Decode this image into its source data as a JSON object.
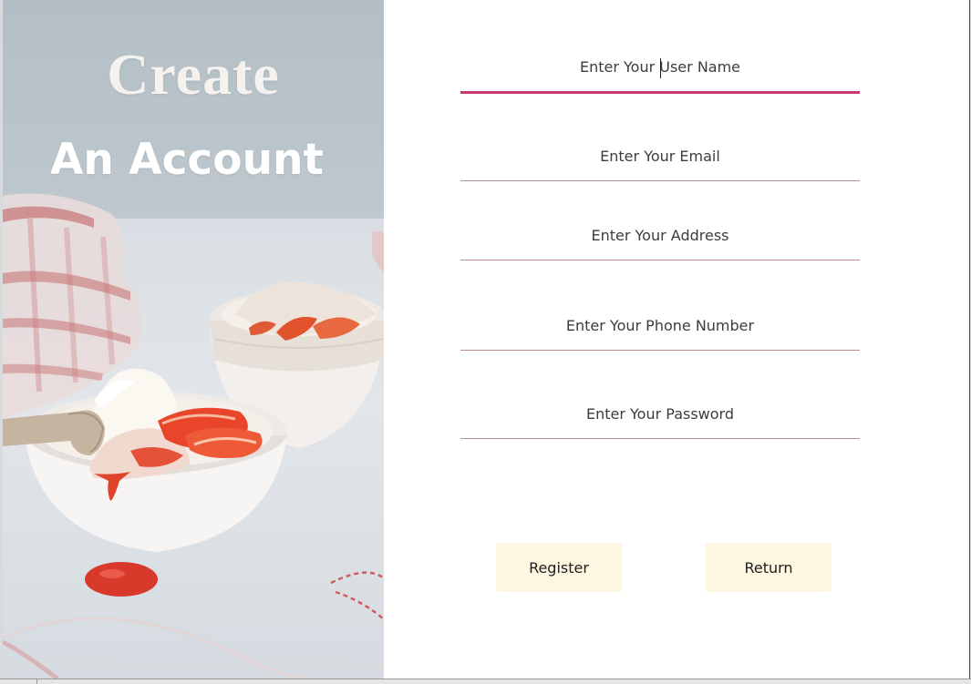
{
  "hero": {
    "title_line1": "Create",
    "title_line2": "An Account",
    "image_subject": "strawberry ice cream bowls"
  },
  "form": {
    "fields": [
      {
        "name": "username",
        "placeholder": "Enter Your User Name",
        "active": true
      },
      {
        "name": "email",
        "placeholder": "Enter Your Email",
        "active": false
      },
      {
        "name": "address",
        "placeholder": "Enter Your Address",
        "active": false
      },
      {
        "name": "phone",
        "placeholder": "Enter Your Phone Number",
        "active": false
      },
      {
        "name": "password",
        "placeholder": "Enter Your Password",
        "active": false
      }
    ]
  },
  "buttons": {
    "register_label": "Register",
    "return_label": "Return"
  },
  "colors": {
    "accent_active_underline": "#c5366e",
    "field_underline": "#b88a8a",
    "button_bg": "#fdf6e1"
  }
}
